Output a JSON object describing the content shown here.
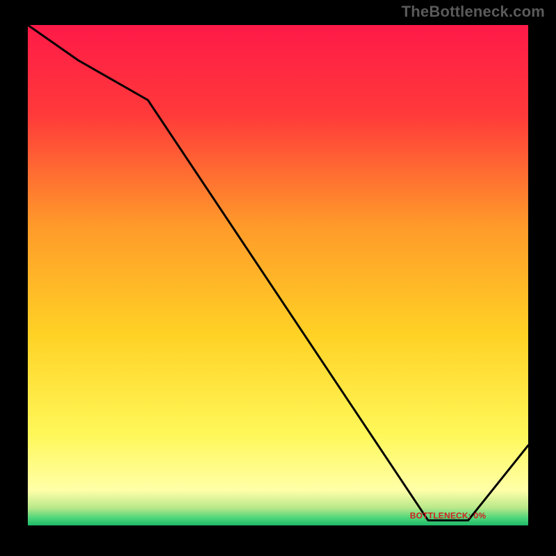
{
  "branding": "TheBottleneck.com",
  "optimal_label": "BOTTLENECK: 0%",
  "chart_data": {
    "type": "line",
    "title": "",
    "xlabel": "",
    "ylabel": "",
    "xlim": [
      0,
      100
    ],
    "ylim": [
      0,
      100
    ],
    "series": [
      {
        "name": "bottleneck-curve",
        "x": [
          0,
          10,
          24,
          80,
          88,
          100
        ],
        "y": [
          100,
          93,
          85,
          1,
          1,
          16
        ]
      }
    ],
    "gradient_stops": [
      {
        "offset": 0.0,
        "color": "#ff1a48"
      },
      {
        "offset": 0.18,
        "color": "#ff3a3a"
      },
      {
        "offset": 0.4,
        "color": "#ff9a2a"
      },
      {
        "offset": 0.62,
        "color": "#ffd225"
      },
      {
        "offset": 0.82,
        "color": "#fff85a"
      },
      {
        "offset": 0.93,
        "color": "#ffffa8"
      },
      {
        "offset": 0.965,
        "color": "#b8e88a"
      },
      {
        "offset": 0.985,
        "color": "#4fd67a"
      },
      {
        "offset": 1.0,
        "color": "#1fb96a"
      }
    ],
    "optimal_marker": {
      "x_start": 80,
      "x_end": 88,
      "y": 1
    }
  }
}
